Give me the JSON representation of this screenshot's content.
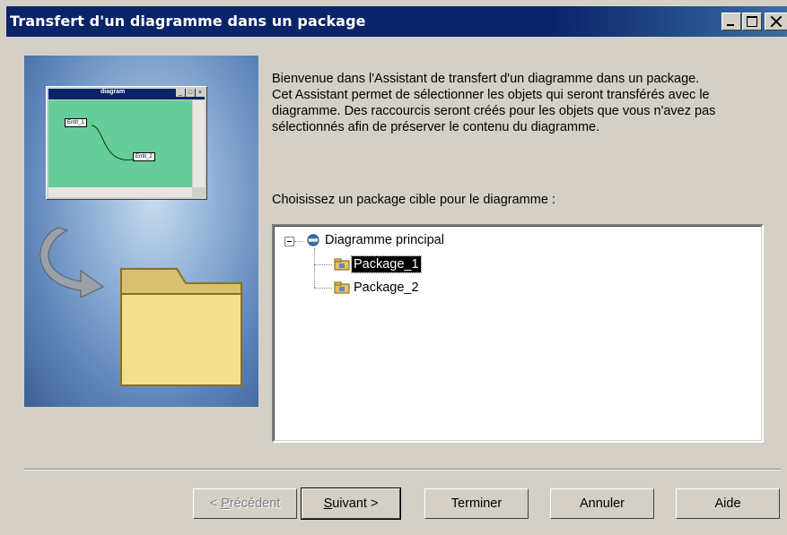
{
  "window": {
    "title": "Transfert d'un diagramme dans un package"
  },
  "illustration": {
    "mini_window_title": "diagram",
    "node_1": "Entit_1",
    "node_2": "Entit_2"
  },
  "intro": {
    "line_1": "Bienvenue dans l'Assistant de transfert d'un diagramme dans un package.",
    "line_2": "Cet Assistant permet de sélectionner les objets qui seront transférés avec le diagramme. Des raccourcis seront créés pour les objets que vous n'avez pas sélectionnés afin de préserver le contenu du diagramme."
  },
  "choose_label": "Choisissez un package cible pour le diagramme :",
  "tree": {
    "root": {
      "label": "Diagramme principal",
      "icon": "diagram-icon"
    },
    "children": [
      {
        "label": "Package_1",
        "icon": "package-icon",
        "selected": true
      },
      {
        "label": "Package_2",
        "icon": "package-icon",
        "selected": false
      }
    ]
  },
  "buttons": {
    "previous": {
      "prefix": "< ",
      "accel": "P",
      "rest": "récédent"
    },
    "next": {
      "accel": "S",
      "rest": "uivant >"
    },
    "finish": "Terminer",
    "cancel": "Annuler",
    "help": "Aide"
  },
  "colors": {
    "titlebar": "#0a246a",
    "face": "#d4d0c8",
    "selection": "#000000"
  }
}
